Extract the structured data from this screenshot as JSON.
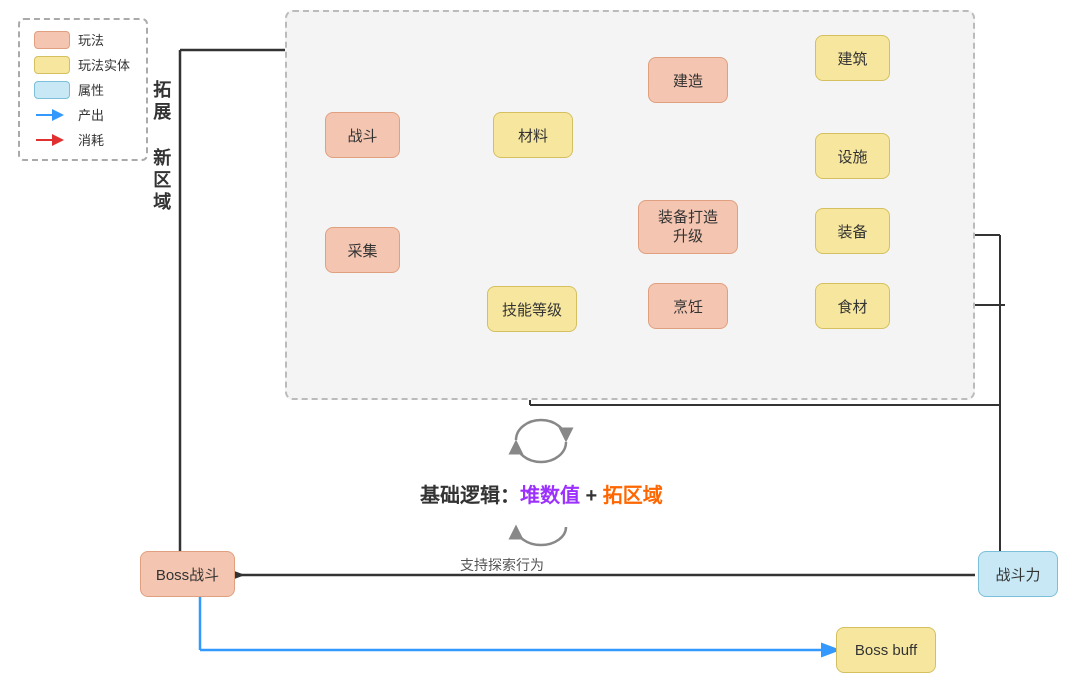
{
  "legend": {
    "items": [
      {
        "label": "玩法",
        "type": "pink-box"
      },
      {
        "label": "玩法实体",
        "type": "yellow-box"
      },
      {
        "label": "属性",
        "type": "blue-box"
      },
      {
        "label": "产出",
        "type": "blue-arrow"
      },
      {
        "label": "消耗",
        "type": "red-arrow"
      }
    ]
  },
  "nodes": {
    "zhandou": "战斗",
    "cailiao": "材料",
    "caiji": "采集",
    "jineng": "技能等级",
    "jianzao": "建造",
    "jianzhu": "建筑",
    "sheshi": "设施",
    "zhuangbei_dazao": "装备打造\n升级",
    "zhuangbei": "装备",
    "pengren": "烹饪",
    "shicai": "食材",
    "boss_zhandou": "Boss战斗",
    "zhandouli": "战斗力",
    "boss_buff": "Boss buff",
    "tuozhan": "拓展\n新区域"
  },
  "texts": {
    "basic_logic": "基础逻辑：",
    "purple_text": "堆数值",
    "plus": " + ",
    "orange_text": "拓区域",
    "support_text": "支持探索行为"
  }
}
